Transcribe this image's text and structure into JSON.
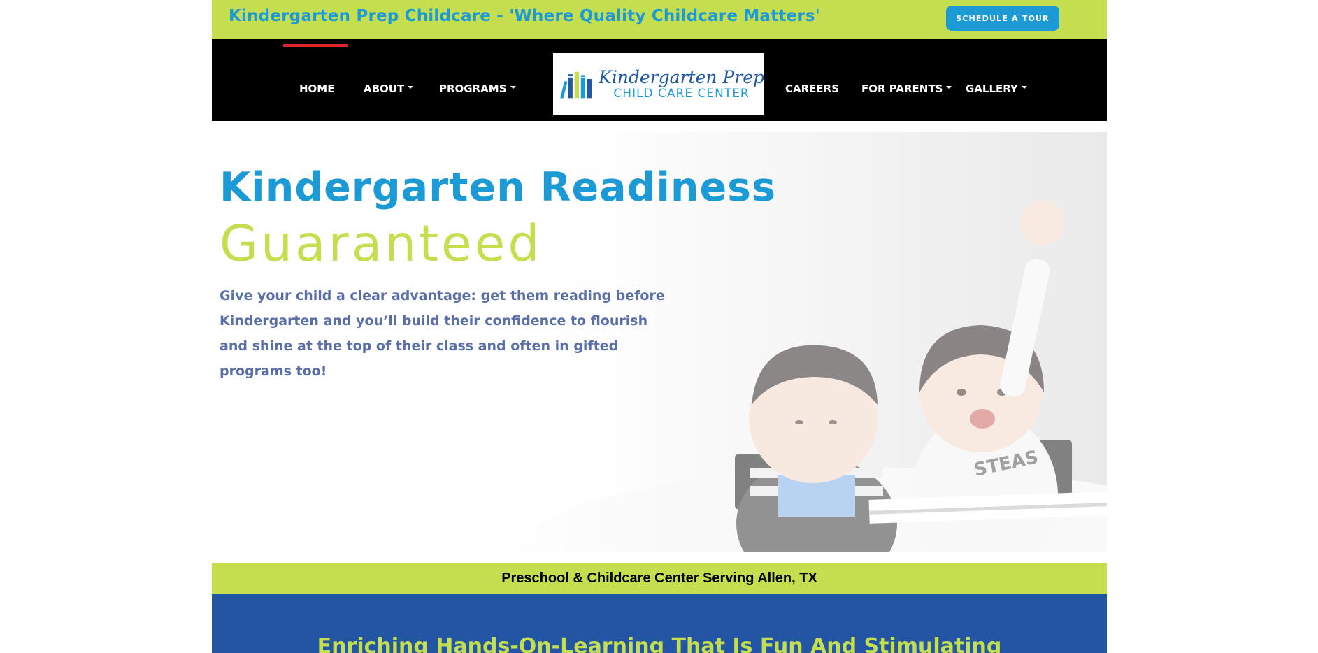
{
  "topbar": {
    "tagline": "Kindergarten Prep Childcare - 'Where Quality Childcare Matters'",
    "tour_button": "SCHEDULE A TOUR"
  },
  "nav": {
    "left_items": [
      {
        "label": "HOME",
        "dropdown": false,
        "active": true
      },
      {
        "label": "ABOUT",
        "dropdown": true
      },
      {
        "label": "PROGRAMS",
        "dropdown": true
      }
    ],
    "right_items": [
      {
        "label": "CAREERS",
        "dropdown": false
      },
      {
        "label": "FOR PARENTS",
        "dropdown": true
      },
      {
        "label": "GALLERY",
        "dropdown": true
      }
    ],
    "logo": {
      "name": "Kindergarten Prep",
      "subtitle": "CHILD CARE CENTER"
    }
  },
  "hero": {
    "heading_line1": "Kindergarten Readiness",
    "heading_line2": "Guaranteed",
    "lead": "Give your child a clear advantage: get them reading before Kindergarten and you’ll build their confidence to flourish and shine at the top of their class and often in gifted programs too!"
  },
  "strip": {
    "text": "Preschool & Childcare Center Serving Allen, TX"
  },
  "section": {
    "heading": "Enriching Hands-On-Learning That Is Fun And Stimulating"
  },
  "colors": {
    "accent_green": "#c5de4f",
    "accent_blue": "#1c9ad6",
    "navy": "#2255a4",
    "active_red": "#e0242a"
  }
}
